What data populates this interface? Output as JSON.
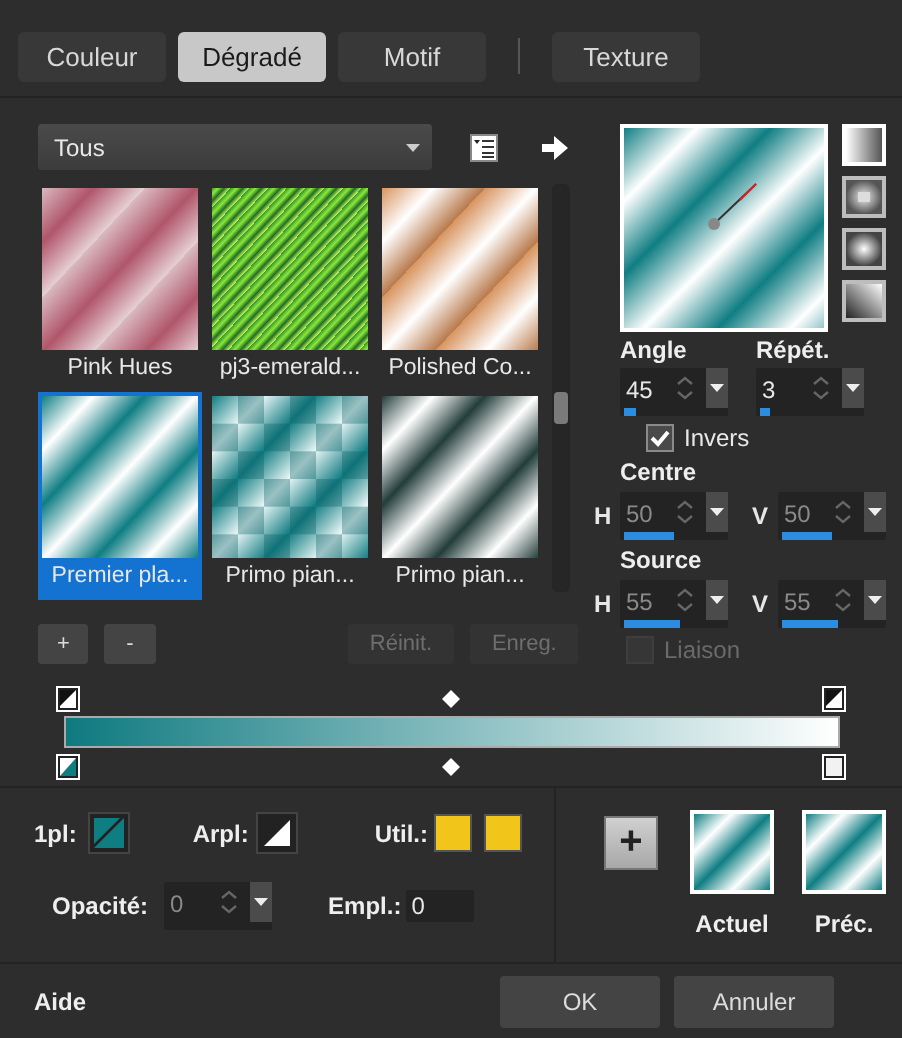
{
  "tabs": [
    {
      "label": "Couleur",
      "selected": false
    },
    {
      "label": "Dégradé",
      "selected": true
    },
    {
      "label": "Motif",
      "selected": false
    },
    {
      "label": "Texture",
      "selected": false
    }
  ],
  "category": {
    "value": "Tous"
  },
  "gallery": [
    {
      "label": "Pink Hues",
      "kind": "pink",
      "selected": false
    },
    {
      "label": "pj3-emerald...",
      "kind": "emerald",
      "selected": false
    },
    {
      "label": "Polished Co...",
      "kind": "copper",
      "selected": false
    },
    {
      "label": "Premier pla...",
      "kind": "teal",
      "selected": true
    },
    {
      "label": "Primo pian...",
      "kind": "checker",
      "selected": false
    },
    {
      "label": "Primo pian...",
      "kind": "dark",
      "selected": false
    }
  ],
  "gallery_buttons": [
    {
      "label": "+",
      "disabled": false
    },
    {
      "label": "-",
      "disabled": false
    },
    {
      "label": "Réinit.",
      "disabled": true
    },
    {
      "label": "Enreg.",
      "disabled": true
    }
  ],
  "styles": [
    {
      "kind": "linear",
      "selected": true
    },
    {
      "kind": "rect",
      "selected": false
    },
    {
      "kind": "radial",
      "selected": false
    },
    {
      "kind": "corner",
      "selected": false
    }
  ],
  "angle": {
    "label": "Angle",
    "value": "45",
    "level": 0.12
  },
  "repeat": {
    "label": "Répét.",
    "value": "3",
    "level": 0.1
  },
  "invert": {
    "label": "Invers",
    "checked": true
  },
  "centre": {
    "label": "Centre",
    "h": {
      "label": "H",
      "value": "50",
      "level": 0.5,
      "disabled": true
    },
    "v": {
      "label": "V",
      "value": "50",
      "level": 0.5,
      "disabled": true
    }
  },
  "source": {
    "label": "Source",
    "h": {
      "label": "H",
      "value": "55",
      "level": 0.55,
      "disabled": true
    },
    "v": {
      "label": "V",
      "value": "55",
      "level": 0.55,
      "disabled": true
    }
  },
  "link": {
    "label": "Liaison",
    "checked": false,
    "disabled": true
  },
  "colors": {
    "fg_label": "1pl:",
    "bg_label": "Arpl:",
    "user_label": "Util.:"
  },
  "opacity": {
    "label": "Opacité:",
    "value": "0",
    "disabled": true
  },
  "location": {
    "label": "Empl.:",
    "value": "0"
  },
  "compare": {
    "add": "+",
    "current": "Actuel",
    "previous": "Préc."
  },
  "footer": {
    "help": "Aide",
    "ok": "OK",
    "cancel": "Annuler"
  }
}
